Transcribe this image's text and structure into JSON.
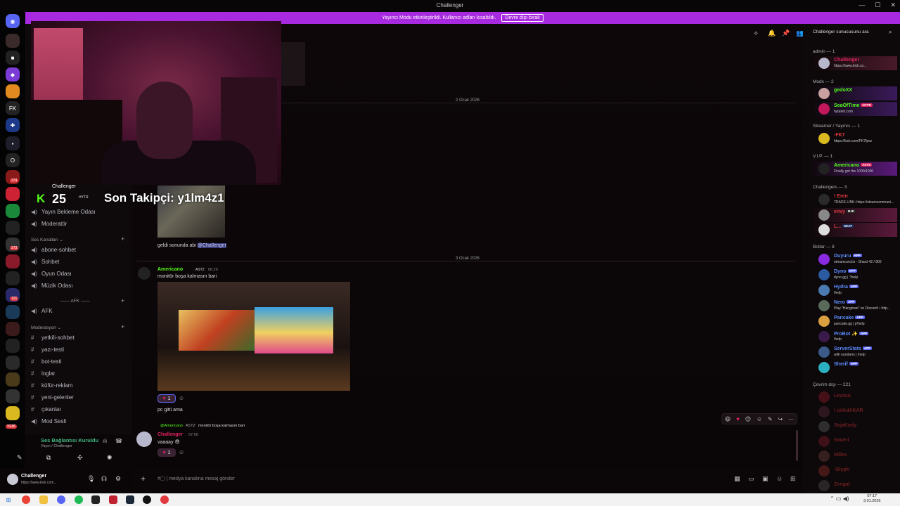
{
  "window": {
    "title": "Challenger",
    "controls": [
      "—",
      "☐",
      "✕"
    ]
  },
  "banner": {
    "text": "Yayıncı Modu etkinleştirildi. Kullanıcı adları kısaltıldı.",
    "button": "Devre dışı bırak"
  },
  "rail": {
    "badges": [
      "8",
      "374",
      "273",
      "101",
      "YENİ"
    ]
  },
  "overlay": {
    "channel_name": "Challenger",
    "count": "25",
    "badge": "HYTR",
    "follow_text": "Son Takipçi: y1lm4z1"
  },
  "sidebar": {
    "channels_top": [
      {
        "label": "Yayın Bekleme Odası",
        "icon": "speaker-icon"
      },
      {
        "label": "Moderatör",
        "icon": "speaker-icon"
      }
    ],
    "cat_voice": "Ses Kanalları",
    "voice_channels": [
      {
        "label": "abone-sohbet",
        "icon": "hash-icon"
      },
      {
        "label": "Sohbet",
        "icon": "speaker-icon"
      },
      {
        "label": "Oyun Odası",
        "icon": "speaker-icon"
      },
      {
        "label": "Müzik Odası",
        "icon": "speaker-icon"
      }
    ],
    "cat_afk": "AFK",
    "afk_channel": "AFK",
    "cat_mod": "Moderasyon",
    "mod_channels": [
      {
        "label": "yetkili-sohbet",
        "icon": "hash-icon"
      },
      {
        "label": "yazı-testi",
        "icon": "hash-icon"
      },
      {
        "label": "bot-testi",
        "icon": "hash-icon"
      },
      {
        "label": "loglar",
        "icon": "hash-icon"
      },
      {
        "label": "küfür-reklam",
        "icon": "hash-icon"
      },
      {
        "label": "yeni-gelenler",
        "icon": "hash-icon"
      },
      {
        "label": "çıkanlar",
        "icon": "hash-icon"
      },
      {
        "label": "Mod Sesli",
        "icon": "speaker-icon"
      }
    ],
    "voice_status": {
      "title": "Ses Bağlantısı Kuruldu",
      "sub": "Yayın / Challenger"
    }
  },
  "user_panel": {
    "name": "Challenger",
    "status": "https://www.kick.com..."
  },
  "main": {
    "header": {
      "search_placeholder": "Challenger sunucusunu ara"
    },
    "date1": "2 Ocak 2026",
    "msg_prev_text": "geldi sonunda abi",
    "msg_prev_mention": "@Challenger",
    "date2": "3 Ocak 2026",
    "msg2": {
      "author": "Americano",
      "tag": "ASTZ",
      "time": "06:29",
      "text": "monitör boşa kalmasın bari"
    },
    "reaction1": {
      "emoji": "♥",
      "count": "1"
    },
    "msg3_text": "pc gitti ama",
    "reply": {
      "author": "@Americano",
      "tag": "ASTZ",
      "text": "monitör boşa kalmasın bari"
    },
    "msg4": {
      "author": "Challenger",
      "time": "07:00",
      "text": "vaaaay 😎"
    },
    "reaction2": {
      "emoji": "♥",
      "count": "1"
    },
    "composer_placeholder": "medya kanalına mesaj gönder"
  },
  "members": {
    "groups": [
      {
        "label": "admin — 1"
      },
      {
        "label": "Mods — 2"
      },
      {
        "label": "Streamer / Yayıncı — 1"
      },
      {
        "label": "V.I.P. — 1"
      },
      {
        "label": "Challengers — 3"
      },
      {
        "label": "Botlar — 8"
      },
      {
        "label": "Çevrim dışı — 221"
      }
    ],
    "admin": [
      {
        "name": "Challenger",
        "sub": "https://www.kick.co...",
        "color": "#e0245e"
      }
    ],
    "mods": [
      {
        "name": "gedoXX",
        "sub": "",
        "color": "#53fc18"
      },
      {
        "name": "SeaOfTime",
        "sub": "hytaletr.com",
        "color": "#53fc18",
        "tag": "HYTR"
      }
    ],
    "streamer": [
      {
        "name": "-FK7",
        "sub": "https://kick.com/FK7fpsz",
        "color": "#e0393e"
      }
    ],
    "vip": [
      {
        "name": "Americano",
        "sub": "Finally got the 1000/1000",
        "color": "#53fc18",
        "tag": "ASTZ"
      }
    ],
    "challengers": [
      {
        "name": "! Eren",
        "sub": "TRADE LINK: https://steamcommuni...",
        "color": "#e0393e"
      },
      {
        "name": "envy",
        "sub": "",
        "color": "#e0393e",
        "tag": "BJK"
      },
      {
        "name": "L...",
        "sub": "",
        "color": "#e0393e",
        "tag": "SEAF"
      }
    ],
    "bots": [
      {
        "name": "Duyuru",
        "sub": "streamcord.io - Shard 42 / 800",
        "color": "#5b8cff"
      },
      {
        "name": "Dyno",
        "sub": "dyno.gg | ?help",
        "color": "#5b8cff"
      },
      {
        "name": "Hydra",
        "sub": "/help",
        "color": "#5b8cff"
      },
      {
        "name": "Nero",
        "sub": "Play \"Hangman\" on Discord! • http...",
        "color": "#5b8cff"
      },
      {
        "name": "Pancake",
        "sub": "pancake.gg | p!help",
        "color": "#5b8cff"
      },
      {
        "name": "ProBot ✨",
        "sub": "/help",
        "color": "#5b8cff"
      },
      {
        "name": "ServerStats",
        "sub": "with numbers | /help",
        "color": "#5b8cff"
      },
      {
        "name": "Sherif",
        "sub": "",
        "color": "#5b8cff"
      }
    ],
    "bot_tag": "APP",
    "offline": [
      "Levizui",
      "! cilAdAKAR",
      "SojaKody",
      "Saueri",
      "Hilles",
      "-Glyph",
      "Zengal"
    ]
  },
  "taskbar": {
    "time": "07:17",
    "date": "3.01.2026"
  }
}
